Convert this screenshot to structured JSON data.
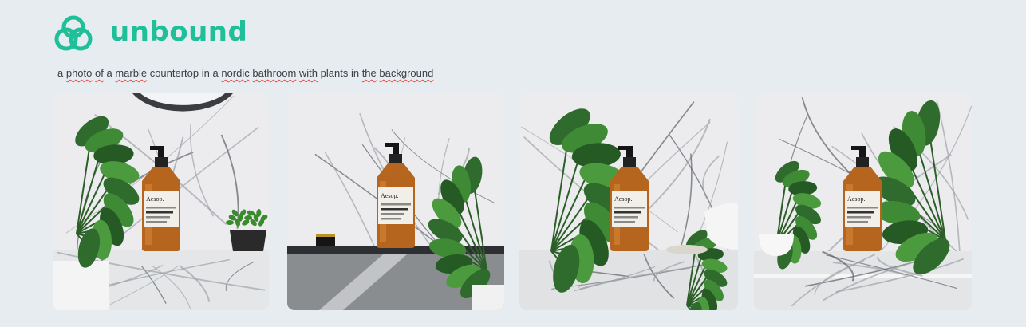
{
  "brand": {
    "name": "unbound",
    "logo_icon": "knot-logo-icon",
    "color": "#1fbf9a"
  },
  "prompt": {
    "words": [
      {
        "t": "a ",
        "u": false
      },
      {
        "t": "photo",
        "u": true
      },
      {
        "t": " ",
        "u": false
      },
      {
        "t": "of",
        "u": true
      },
      {
        "t": " a ",
        "u": false
      },
      {
        "t": "marble",
        "u": true
      },
      {
        "t": " countertop in a ",
        "u": false
      },
      {
        "t": "nordic",
        "u": true
      },
      {
        "t": " ",
        "u": false
      },
      {
        "t": "bathroom",
        "u": true
      },
      {
        "t": " ",
        "u": false
      },
      {
        "t": "with",
        "u": true
      },
      {
        "t": " plants in ",
        "u": false
      },
      {
        "t": "the",
        "u": true
      },
      {
        "t": " ",
        "u": false
      },
      {
        "t": "background",
        "u": true
      }
    ]
  },
  "images": {
    "bottle_label": "Aesop.",
    "items": [
      {
        "variant": 1
      },
      {
        "variant": 2
      },
      {
        "variant": 3
      },
      {
        "variant": 4
      }
    ]
  }
}
